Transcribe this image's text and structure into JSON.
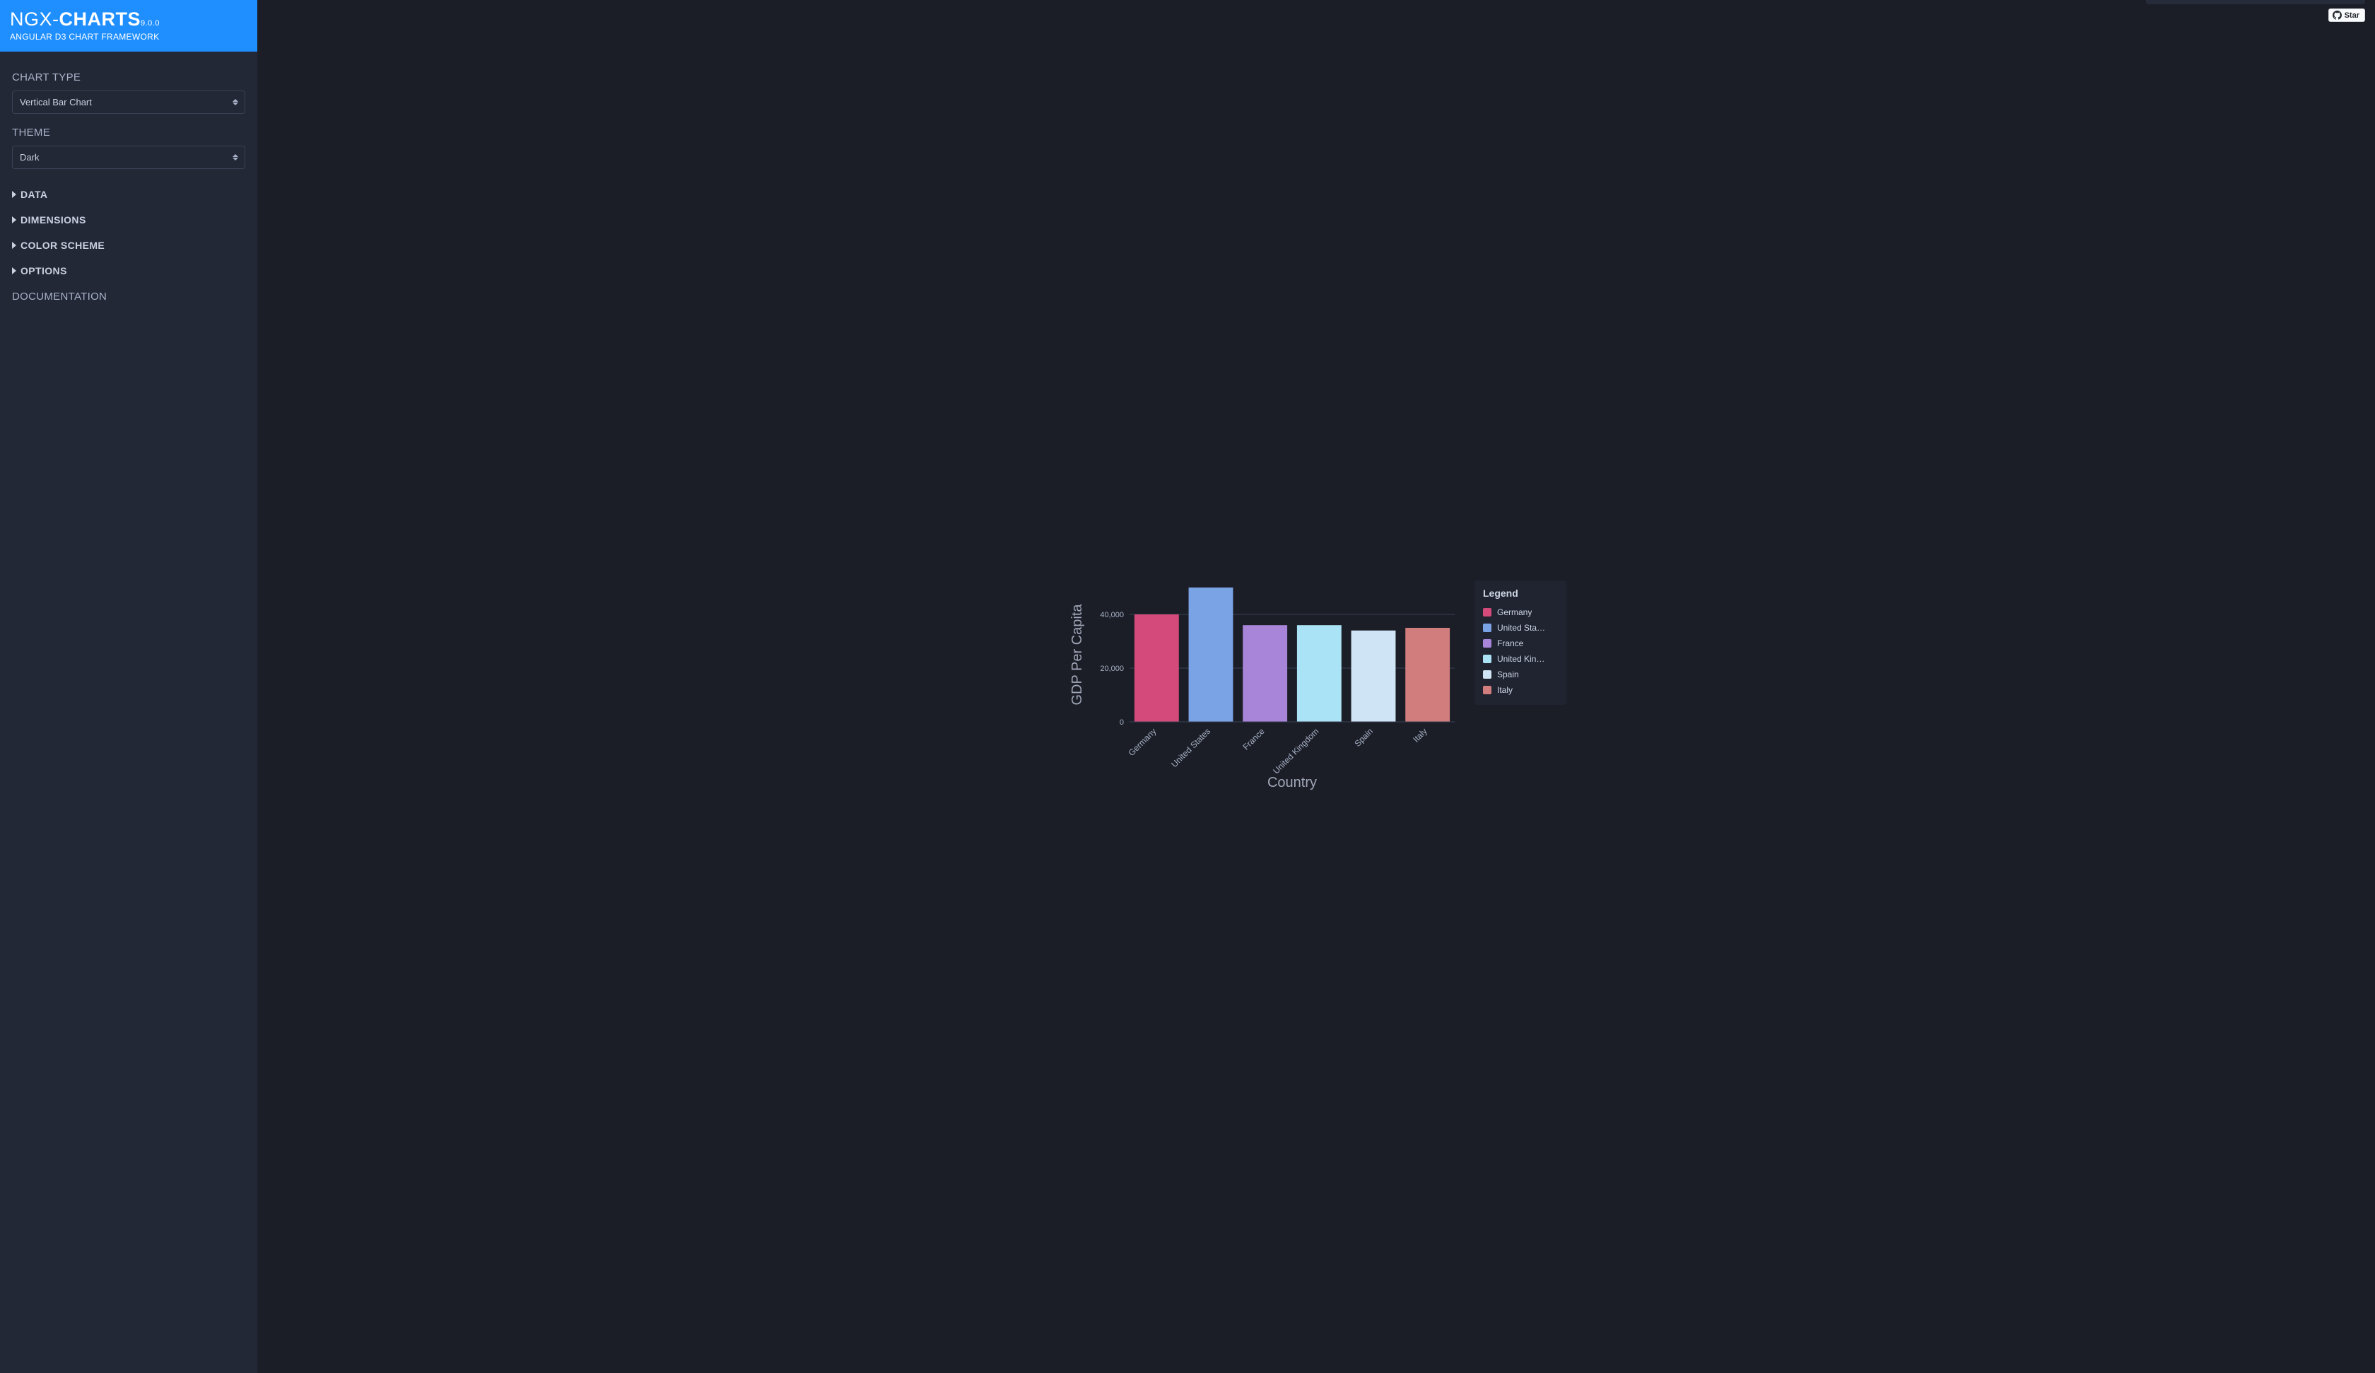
{
  "brand": {
    "prefix": "NGX-",
    "name": "CHARTS",
    "version": "9.0.0",
    "subtitle": "ANGULAR D3 CHART FRAMEWORK"
  },
  "sidebar": {
    "chart_type_label": "CHART TYPE",
    "chart_type_value": "Vertical Bar Chart",
    "theme_label": "THEME",
    "theme_value": "Dark",
    "accordion": [
      {
        "label": "DATA"
      },
      {
        "label": "DIMENSIONS"
      },
      {
        "label": "COLOR SCHEME"
      },
      {
        "label": "OPTIONS"
      }
    ],
    "documentation_label": "DOCUMENTATION"
  },
  "topbar": {
    "star_label": "Star"
  },
  "legend": {
    "title": "Legend",
    "items": [
      {
        "label": "Germany",
        "display": "Germany",
        "color": "#d44a7a"
      },
      {
        "label": "United States",
        "display": "United Sta…",
        "color": "#7aa3e5"
      },
      {
        "label": "France",
        "display": "France",
        "color": "#a885d8"
      },
      {
        "label": "United Kingdom",
        "display": "United Kin…",
        "color": "#aae3f5"
      },
      {
        "label": "Spain",
        "display": "Spain",
        "color": "#cfe4f5"
      },
      {
        "label": "Italy",
        "display": "Italy",
        "color": "#d27d7d"
      }
    ]
  },
  "chart_data": {
    "type": "bar",
    "xlabel": "Country",
    "ylabel": "GDP Per Capita",
    "ylim": [
      0,
      50000
    ],
    "yticks": [
      0,
      20000,
      40000
    ],
    "ytick_labels": [
      "0",
      "20,000",
      "40,000"
    ],
    "categories": [
      "Germany",
      "United States",
      "France",
      "United Kingdom",
      "Spain",
      "Italy"
    ],
    "values": [
      40000,
      50000,
      36000,
      36000,
      34000,
      35000
    ],
    "colors": [
      "#d44a7a",
      "#7aa3e5",
      "#a885d8",
      "#aae3f5",
      "#cfe4f5",
      "#d27d7d"
    ]
  }
}
